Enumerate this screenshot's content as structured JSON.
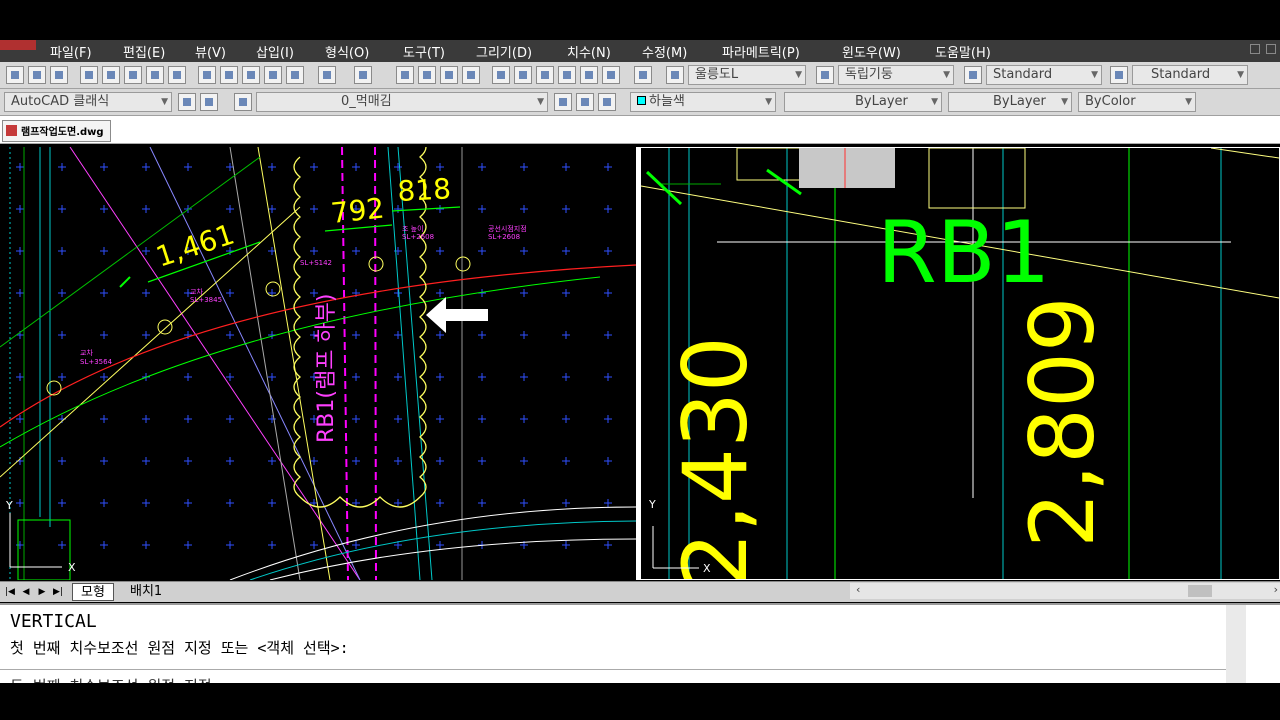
{
  "menu": {
    "items": [
      "파일(F)",
      "편집(E)",
      "뷰(V)",
      "삽입(I)",
      "형식(O)",
      "도구(T)",
      "그리기(D)",
      "치수(N)",
      "수정(M)",
      "파라메트릭(P)",
      "윈도우(W)",
      "도움말(H)"
    ]
  },
  "toolbar1": {
    "text_style": "울릉도L",
    "dim_style": "독립기둥",
    "table_style": "Standard",
    "multileader_style": "Standard"
  },
  "toolbar2": {
    "workspace": "AutoCAD 클래식",
    "layer": "0_먹매김",
    "color": "하늘색",
    "linetype": "ByLayer",
    "lineweight": "ByLayer",
    "plotstyle": "ByColor"
  },
  "file_tab": {
    "name": "램프작업도면.dwg"
  },
  "drawing_left": {
    "dims": [
      "1,461",
      "792",
      "818"
    ],
    "vertical_label": "RB1(램프 하부)",
    "small_labels": [
      "교차",
      "SL+3845",
      "교차",
      "SL+3564",
      "SL+S142",
      "조 높이",
      "SL+2608",
      "공선시점지점",
      "SL+2608"
    ],
    "ucs_y": "Y",
    "ucs_x": "X"
  },
  "drawing_right": {
    "label": "RB1",
    "dims": [
      "2,430",
      "2,809"
    ],
    "ucs_y": "Y",
    "ucs_x": "X"
  },
  "layout_tabs": {
    "model": "모형",
    "layout1": "배치1"
  },
  "command": {
    "line1": "VERTICAL",
    "line2": "첫 번째 치수보조선 원점 지정 또는 <객체 선택>:",
    "line3": "두 번째 치수보조선 원점 지정"
  },
  "colors": {
    "cad_bg": "#000000",
    "dim_yellow": "#ffff00",
    "label_green": "#00ff00",
    "magenta": "#ff00ff",
    "cyan": "#00c8c8"
  }
}
